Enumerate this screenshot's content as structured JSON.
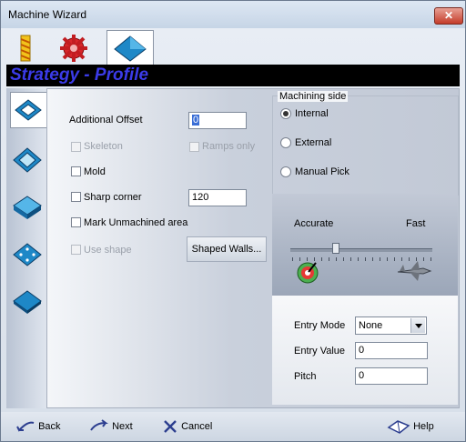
{
  "window": {
    "title": "Machine Wizard",
    "close_label": "✕"
  },
  "header": {
    "strategy_title": "Strategy - Profile"
  },
  "options": {
    "additional_offset_label": "Additional Offset",
    "additional_offset_value": "0",
    "skeleton_label": "Skeleton",
    "ramps_only_label": "Ramps only",
    "mold_label": "Mold",
    "sharp_corner_label": "Sharp corner",
    "sharp_corner_value": "120",
    "mark_unmachined_label": "Mark Unmachined area",
    "use_shape_label": "Use shape",
    "shaped_walls_label": "Shaped Walls..."
  },
  "machining_side": {
    "legend": "Machining side",
    "internal_label": "Internal",
    "external_label": "External",
    "manual_pick_label": "Manual Pick",
    "selected": "Internal"
  },
  "accuracy": {
    "left_label": "Accurate",
    "right_label": "Fast",
    "slider_position": 0.3
  },
  "entry": {
    "entry_mode_label": "Entry Mode",
    "entry_mode_value": "None",
    "entry_value_label": "Entry Value",
    "entry_value_value": "0",
    "pitch_label": "Pitch",
    "pitch_value": "0"
  },
  "footer": {
    "back_label": "Back",
    "next_label": "Next",
    "cancel_label": "Cancel",
    "help_label": "Help"
  }
}
